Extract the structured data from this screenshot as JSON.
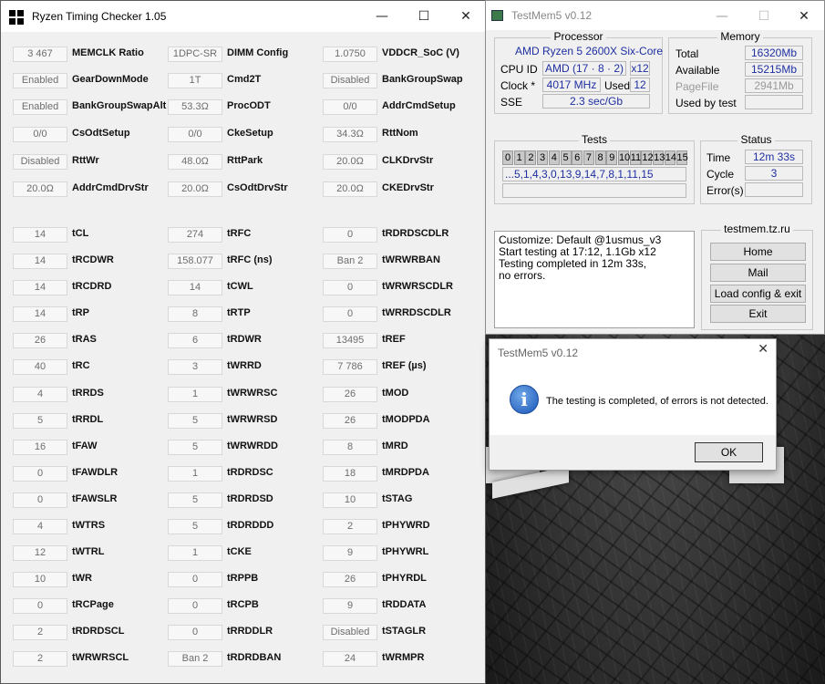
{
  "rtc": {
    "title": "Ryzen Timing Checker 1.05",
    "col1": [
      [
        "3 467",
        "MEMCLK Ratio"
      ],
      [
        "Enabled",
        "GearDownMode"
      ],
      [
        "Enabled",
        "BankGroupSwapAlt"
      ],
      [
        "0/0",
        "CsOdtSetup"
      ],
      [
        "Disabled",
        "RttWr"
      ],
      [
        "20.0Ω",
        "AddrCmdDrvStr"
      ],
      null,
      [
        "14",
        "tCL"
      ],
      [
        "14",
        "tRCDWR"
      ],
      [
        "14",
        "tRCDRD"
      ],
      [
        "14",
        "tRP"
      ],
      [
        "26",
        "tRAS"
      ],
      [
        "40",
        "tRC"
      ],
      [
        "4",
        "tRRDS"
      ],
      [
        "5",
        "tRRDL"
      ],
      [
        "16",
        "tFAW"
      ],
      [
        "0",
        "tFAWDLR"
      ],
      [
        "0",
        "tFAWSLR"
      ],
      [
        "4",
        "tWTRS"
      ],
      [
        "12",
        "tWTRL"
      ],
      [
        "10",
        "tWR"
      ],
      [
        "0",
        "tRCPage"
      ],
      [
        "2",
        "tRDRDSCL"
      ],
      [
        "2",
        "tWRWRSCL"
      ]
    ],
    "col2": [
      [
        "1DPC-SR",
        "DIMM Config"
      ],
      [
        "1T",
        "Cmd2T"
      ],
      [
        "53.3Ω",
        "ProcODT"
      ],
      [
        "0/0",
        "CkeSetup"
      ],
      [
        "48.0Ω",
        "RttPark"
      ],
      [
        "20.0Ω",
        "CsOdtDrvStr"
      ],
      null,
      [
        "274",
        "tRFC"
      ],
      [
        "158.077",
        "tRFC (ns)"
      ],
      [
        "14",
        "tCWL"
      ],
      [
        "8",
        "tRTP"
      ],
      [
        "6",
        "tRDWR"
      ],
      [
        "3",
        "tWRRD"
      ],
      [
        "1",
        "tWRWRSC"
      ],
      [
        "5",
        "tWRWRSD"
      ],
      [
        "5",
        "tWRWRDD"
      ],
      [
        "1",
        "tRDRDSC"
      ],
      [
        "5",
        "tRDRDSD"
      ],
      [
        "5",
        "tRDRDDD"
      ],
      [
        "1",
        "tCKE"
      ],
      [
        "0",
        "tRPPB"
      ],
      [
        "0",
        "tRCPB"
      ],
      [
        "0",
        "tRRDDLR"
      ],
      [
        "Ban 2",
        "tRDRDBAN"
      ]
    ],
    "col3": [
      [
        "1.0750",
        "VDDCR_SoC (V)"
      ],
      [
        "Disabled",
        "BankGroupSwap"
      ],
      [
        "0/0",
        "AddrCmdSetup"
      ],
      [
        "34.3Ω",
        "RttNom"
      ],
      [
        "20.0Ω",
        "CLKDrvStr"
      ],
      [
        "20.0Ω",
        "CKEDrvStr"
      ],
      null,
      [
        "0",
        "tRDRDSCDLR"
      ],
      [
        "Ban 2",
        "tWRWRBAN"
      ],
      [
        "0",
        "tWRWRSCDLR"
      ],
      [
        "0",
        "tWRRDSCDLR"
      ],
      [
        "13495",
        "tREF"
      ],
      [
        "7 786",
        "tREF (µs)"
      ],
      [
        "26",
        "tMOD"
      ],
      [
        "26",
        "tMODPDA"
      ],
      [
        "8",
        "tMRD"
      ],
      [
        "18",
        "tMRDPDA"
      ],
      [
        "10",
        "tSTAG"
      ],
      [
        "2",
        "tPHYWRD"
      ],
      [
        "9",
        "tPHYWRL"
      ],
      [
        "26",
        "tPHYRDL"
      ],
      [
        "9",
        "tRDDATA"
      ],
      [
        "Disabled",
        "tSTAGLR"
      ],
      [
        "24",
        "tWRMPR"
      ]
    ]
  },
  "tm": {
    "title": "TestMem5 v0.12",
    "processor": {
      "heading": "Processor",
      "name": "AMD Ryzen 5 2600X Six-Core",
      "cpuid_label": "CPU ID",
      "cpuid": "AMD  (17 · 8 · 2)",
      "threads": "x12",
      "clock_label": "Clock *",
      "clock": "4017 MHz",
      "used_label": "Used",
      "used": "12",
      "sse_label": "SSE",
      "sse": "2.3 sec/Gb"
    },
    "memory": {
      "heading": "Memory",
      "total_label": "Total",
      "total": "16320Mb",
      "available_label": "Available",
      "available": "15215Mb",
      "pagefile_label": "PageFile",
      "pagefile": "2941Mb",
      "usedbytest_label": "Used by test",
      "usedbytest": ""
    },
    "tests": {
      "heading": "Tests",
      "numbers": [
        "0",
        "1",
        "2",
        "3",
        "4",
        "5",
        "6",
        "7",
        "8",
        "9",
        "10",
        "11",
        "12",
        "13",
        "14",
        "15"
      ],
      "sequence": "...5,1,4,3,0,13,9,14,7,8,1,11,15",
      "current": ""
    },
    "status": {
      "heading": "Status",
      "time_label": "Time",
      "time": "12m 33s",
      "cycle_label": "Cycle",
      "cycle": "3",
      "errors_label": "Error(s)",
      "errors": ""
    },
    "log": [
      "Customize: Default @1usmus_v3",
      "Start testing at 17:12, 1.1Gb x12",
      "Testing completed in 12m 33s,",
      "no errors."
    ],
    "site": {
      "heading": "testmem.tz.ru",
      "buttons": [
        "Home",
        "Mail",
        "Load config & exit",
        "Exit"
      ]
    }
  },
  "dialog": {
    "title": "TestMem5 v0.12",
    "message": "The testing is completed, of errors is not detected.",
    "ok": "OK",
    "icon": "i"
  },
  "controls": {
    "minimize": "—",
    "maximize": "☐",
    "close": "✕",
    "dlg_close": "✕"
  }
}
